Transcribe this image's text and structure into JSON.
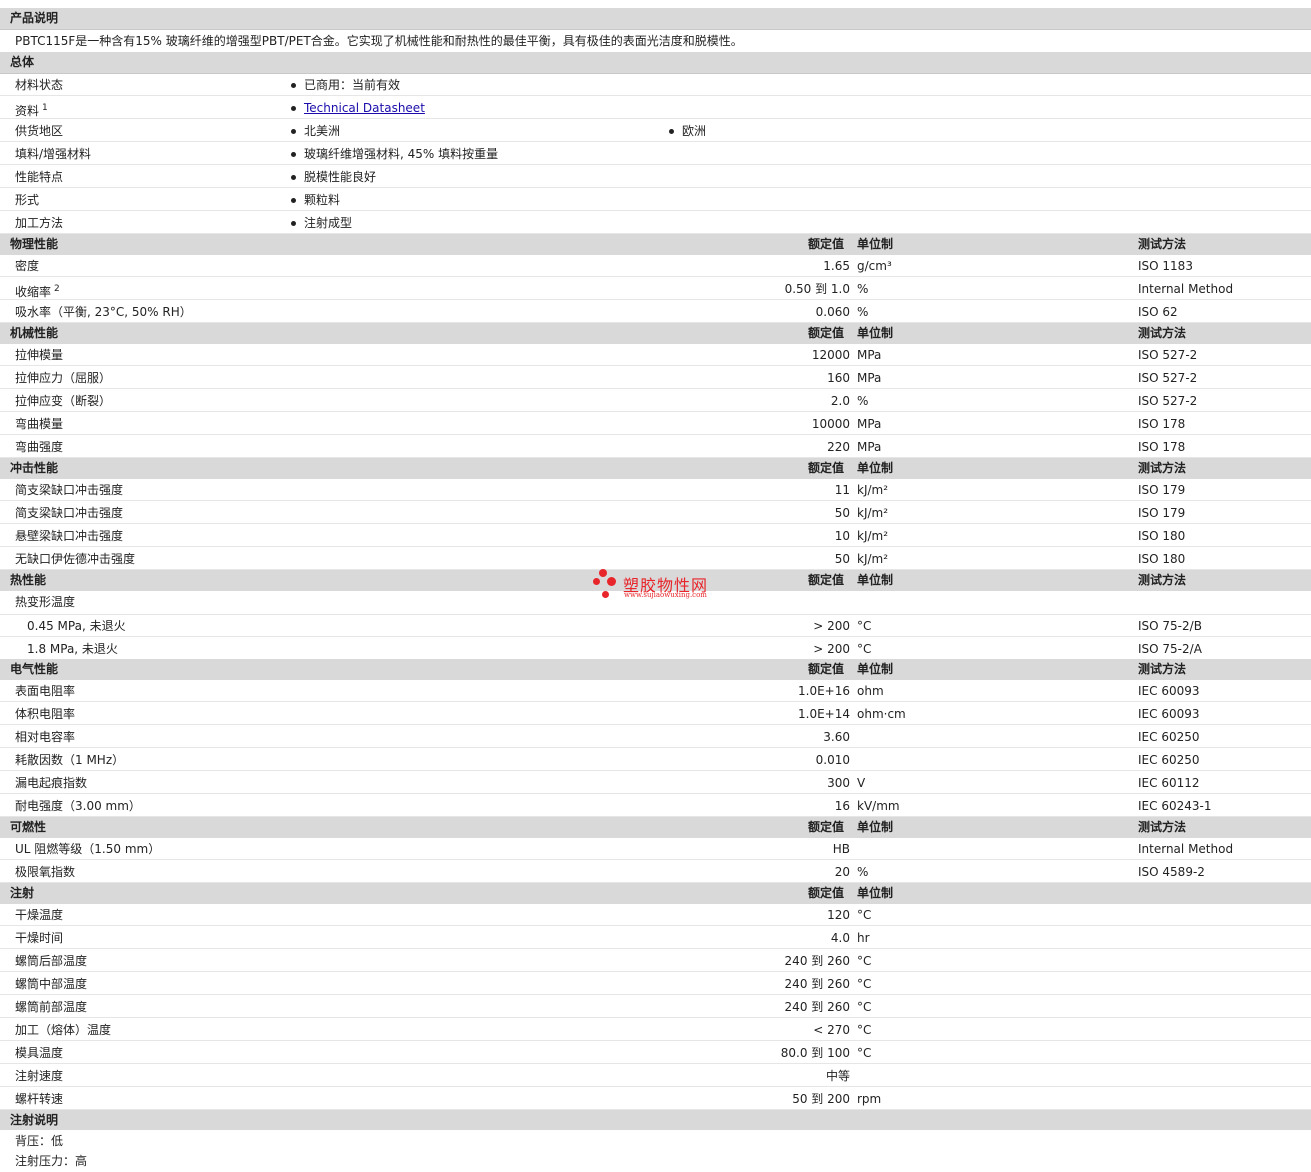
{
  "desc": {
    "title": "产品说明",
    "text": "PBTC115F是一种含有15% 玻璃纤维的增强型PBT/PET合金。它实现了机械性能和耐热性的最佳平衡，具有极佳的表面光洁度和脱模性。"
  },
  "general": {
    "title": "总体",
    "status_label": "材料状态",
    "status_value": "已商用：当前有效",
    "docs_label": "资料",
    "docs_sup": "1",
    "docs_link": "Technical Datasheet",
    "region_label": "供货地区",
    "region_1": "北美洲",
    "region_2": "欧洲",
    "filler_label": "填料/增强材料",
    "filler_value": "玻璃纤维增强材料, 45% 填料按重量",
    "feature_label": "性能特点",
    "feature_value": "脱模性能良好",
    "form_label": "形式",
    "form_value": "颗粒料",
    "process_label": "加工方法",
    "process_value": "注射成型"
  },
  "cols": {
    "value": "额定值",
    "unit": "单位制",
    "method": "测试方法"
  },
  "physical": {
    "title": "物理性能",
    "rows": [
      {
        "label": "密度",
        "value": "1.65",
        "unit": "g/cm³",
        "method": "ISO 1183"
      },
      {
        "label": "收缩率",
        "value": "0.50 到  1.0",
        "unit": "%",
        "method": "Internal Method"
      },
      {
        "label": "吸水率（平衡, 23°C, 50% RH）",
        "value": "0.060",
        "unit": "%",
        "method": "ISO 62"
      }
    ],
    "shrink_sup": "2"
  },
  "mechanical": {
    "title": "机械性能",
    "rows": [
      {
        "label": "拉伸模量",
        "value": "12000",
        "unit": "MPa",
        "method": "ISO 527-2"
      },
      {
        "label": "拉伸应力（屈服）",
        "value": "160",
        "unit": "MPa",
        "method": "ISO 527-2"
      },
      {
        "label": "拉伸应变（断裂）",
        "value": "2.0",
        "unit": "%",
        "method": "ISO 527-2"
      },
      {
        "label": "弯曲模量",
        "value": "10000",
        "unit": "MPa",
        "method": "ISO 178"
      },
      {
        "label": "弯曲强度",
        "value": "220",
        "unit": "MPa",
        "method": "ISO 178"
      }
    ]
  },
  "impact": {
    "title": "冲击性能",
    "rows": [
      {
        "label": "简支梁缺口冲击强度",
        "value": "11",
        "unit": "kJ/m²",
        "method": "ISO 179"
      },
      {
        "label": "简支梁缺口冲击强度",
        "value": "50",
        "unit": "kJ/m²",
        "method": "ISO 179"
      },
      {
        "label": "悬壁梁缺口冲击强度",
        "value": "10",
        "unit": "kJ/m²",
        "method": "ISO 180"
      },
      {
        "label": "无缺口伊佐德冲击强度",
        "value": "50",
        "unit": "kJ/m²",
        "method": "ISO 180"
      }
    ]
  },
  "thermal": {
    "title": "热性能",
    "hdt_label": "热变形温度",
    "rows": [
      {
        "label": "0.45 MPa, 未退火",
        "value": "> 200",
        "unit": "°C",
        "method": "ISO 75-2/B"
      },
      {
        "label": "1.8 MPa, 未退火",
        "value": "> 200",
        "unit": "°C",
        "method": "ISO 75-2/A"
      }
    ]
  },
  "electrical": {
    "title": "电气性能",
    "rows": [
      {
        "label": "表面电阻率",
        "value": "1.0E+16",
        "unit": "ohm",
        "method": "IEC 60093"
      },
      {
        "label": "体积电阻率",
        "value": "1.0E+14",
        "unit": "ohm·cm",
        "method": "IEC 60093"
      },
      {
        "label": "相对电容率",
        "value": "3.60",
        "unit": "",
        "method": "IEC 60250"
      },
      {
        "label": "耗散因数（1 MHz）",
        "value": "0.010",
        "unit": "",
        "method": "IEC 60250"
      },
      {
        "label": "漏电起痕指数",
        "value": "300",
        "unit": "V",
        "method": "IEC 60112"
      },
      {
        "label": "耐电强度（3.00 mm）",
        "value": "16",
        "unit": "kV/mm",
        "method": "IEC 60243-1"
      }
    ]
  },
  "flammability": {
    "title": "可燃性",
    "rows": [
      {
        "label": "UL 阻燃等级（1.50 mm）",
        "value": "HB",
        "unit": "",
        "method": "Internal Method"
      },
      {
        "label": "极限氧指数",
        "value": "20",
        "unit": "%",
        "method": "ISO 4589-2"
      }
    ]
  },
  "injection": {
    "title": "注射",
    "rows": [
      {
        "label": "干燥温度",
        "value": "120",
        "unit": "°C"
      },
      {
        "label": "干燥时间",
        "value": "4.0",
        "unit": "hr"
      },
      {
        "label": "螺筒后部温度",
        "value": "240 到  260",
        "unit": "°C"
      },
      {
        "label": "螺筒中部温度",
        "value": "240 到  260",
        "unit": "°C"
      },
      {
        "label": "螺筒前部温度",
        "value": "240 到  260",
        "unit": "°C"
      },
      {
        "label": "加工（熔体）温度",
        "value": "< 270",
        "unit": "°C"
      },
      {
        "label": "模具温度",
        "value": "80.0 到  100",
        "unit": "°C"
      },
      {
        "label": "注射速度",
        "value": "中等",
        "unit": ""
      },
      {
        "label": "螺杆转速",
        "value": "50 到  200",
        "unit": "rpm"
      }
    ]
  },
  "notes": {
    "title": "注射说明",
    "line1": "背压：低",
    "line2": "注射压力：高"
  },
  "watermark": {
    "name": "塑胶物性网",
    "url": "www.sujiaowuxing.com",
    "color": "#e8252a"
  }
}
